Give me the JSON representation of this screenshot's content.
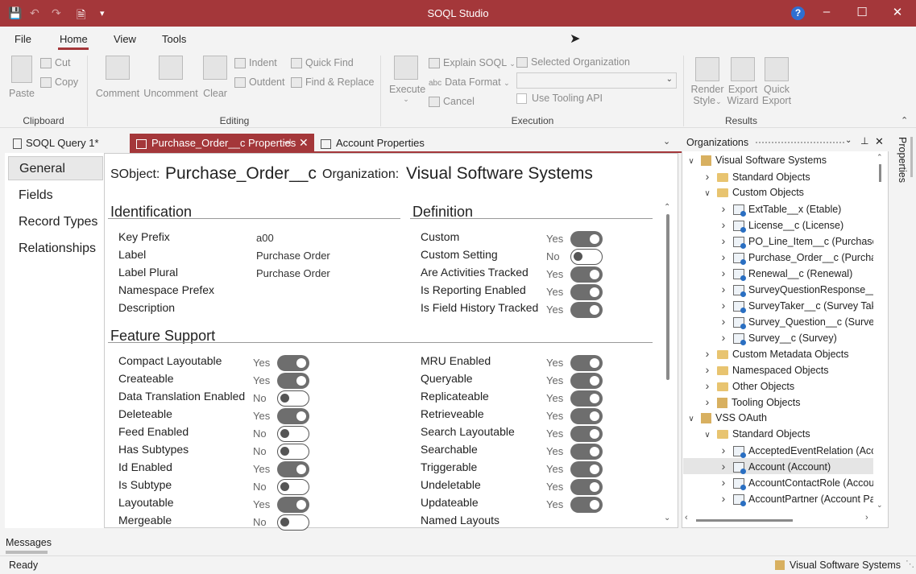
{
  "window": {
    "title": "SOQL Studio"
  },
  "menu": {
    "file": "File",
    "home": "Home",
    "view": "View",
    "tools": "Tools"
  },
  "ribbon": {
    "paste": "Paste",
    "cut": "Cut",
    "copy": "Copy",
    "clipboard_group": "Clipboard",
    "comment": "Comment",
    "uncomment": "Uncomment",
    "clear": "Clear",
    "indent": "Indent",
    "outdent": "Outdent",
    "quick_find": "Quick Find",
    "find_replace": "Find & Replace",
    "editing_group": "Editing",
    "execute": "Execute",
    "explain_soql": "Explain SOQL",
    "data_format": "Data Format",
    "cancel": "Cancel",
    "selected_org": "Selected Organization",
    "use_tooling_api": "Use Tooling API",
    "execution_group": "Execution",
    "render_style_1": "Render",
    "render_style_2": "Style",
    "export_wizard_1": "Export",
    "export_wizard_2": "Wizard",
    "quick_export_1": "Quick",
    "quick_export_2": "Export",
    "results_group": "Results"
  },
  "tabs": [
    {
      "label": "SOQL Query 1*"
    },
    {
      "label": "Purchase_Order__c Properties"
    },
    {
      "label": "Account Properties"
    }
  ],
  "nav": {
    "items": [
      "General",
      "Fields",
      "Record Types",
      "Relationships"
    ]
  },
  "header": {
    "sobject_label": "SObject:",
    "sobject_value": "Purchase_Order__c",
    "org_label": "Organization:",
    "org_value": "Visual Software Systems"
  },
  "identification": {
    "title": "Identification",
    "rows": [
      {
        "label": "Key Prefix",
        "value": "a00"
      },
      {
        "label": "Label",
        "value": "Purchase Order"
      },
      {
        "label": "Label Plural",
        "value": "Purchase Order"
      },
      {
        "label": "Namespace Prefex",
        "value": ""
      },
      {
        "label": "Description",
        "value": ""
      }
    ]
  },
  "definition": {
    "title": "Definition",
    "rows": [
      {
        "label": "Custom",
        "yn": "Yes",
        "on": true
      },
      {
        "label": "Custom Setting",
        "yn": "No",
        "on": false
      },
      {
        "label": "Are Activities Tracked",
        "yn": "Yes",
        "on": true
      },
      {
        "label": "Is Reporting Enabled",
        "yn": "Yes",
        "on": true
      },
      {
        "label": "Is Field History Tracked",
        "yn": "Yes",
        "on": true
      }
    ]
  },
  "feature_support": {
    "title": "Feature Support",
    "left": [
      {
        "label": "Compact Layoutable",
        "yn": "Yes",
        "on": true
      },
      {
        "label": "Createable",
        "yn": "Yes",
        "on": true
      },
      {
        "label": "Data Translation Enabled",
        "yn": "No",
        "on": false
      },
      {
        "label": "Deleteable",
        "yn": "Yes",
        "on": true
      },
      {
        "label": "Feed Enabled",
        "yn": "No",
        "on": false
      },
      {
        "label": "Has Subtypes",
        "yn": "No",
        "on": false
      },
      {
        "label": "Id Enabled",
        "yn": "Yes",
        "on": true
      },
      {
        "label": "Is Subtype",
        "yn": "No",
        "on": false
      },
      {
        "label": "Layoutable",
        "yn": "Yes",
        "on": true
      },
      {
        "label": "Mergeable",
        "yn": "No",
        "on": false
      }
    ],
    "right": [
      {
        "label": "MRU Enabled",
        "yn": "Yes",
        "on": true
      },
      {
        "label": "Queryable",
        "yn": "Yes",
        "on": true
      },
      {
        "label": "Replicateable",
        "yn": "Yes",
        "on": true
      },
      {
        "label": "Retrieveable",
        "yn": "Yes",
        "on": true
      },
      {
        "label": "Search Layoutable",
        "yn": "Yes",
        "on": true
      },
      {
        "label": "Searchable",
        "yn": "Yes",
        "on": true
      },
      {
        "label": "Triggerable",
        "yn": "Yes",
        "on": true
      },
      {
        "label": "Undeletable",
        "yn": "Yes",
        "on": true
      },
      {
        "label": "Updateable",
        "yn": "Yes",
        "on": true
      },
      {
        "label": "Named Layouts",
        "yn": "",
        "on": null
      }
    ]
  },
  "org_panel": {
    "title": "Organizations",
    "tree": [
      {
        "depth": 0,
        "exp": "open",
        "icon": "org",
        "label": "Visual Software Systems"
      },
      {
        "depth": 1,
        "exp": "closed",
        "icon": "folder",
        "label": "Standard Objects"
      },
      {
        "depth": 1,
        "exp": "open",
        "icon": "folder",
        "label": "Custom Objects"
      },
      {
        "depth": 2,
        "exp": "closed",
        "icon": "obj",
        "label": "ExtTable__x (Etable)"
      },
      {
        "depth": 2,
        "exp": "closed",
        "icon": "obj",
        "label": "License__c (License)"
      },
      {
        "depth": 2,
        "exp": "closed",
        "icon": "obj",
        "label": "PO_Line_Item__c (Purchase Or"
      },
      {
        "depth": 2,
        "exp": "closed",
        "icon": "obj",
        "label": "Purchase_Order__c (Purchase"
      },
      {
        "depth": 2,
        "exp": "closed",
        "icon": "obj",
        "label": "Renewal__c (Renewal)"
      },
      {
        "depth": 2,
        "exp": "closed",
        "icon": "obj",
        "label": "SurveyQuestionResponse__c ("
      },
      {
        "depth": 2,
        "exp": "closed",
        "icon": "obj",
        "label": "SurveyTaker__c (Survey Taken)"
      },
      {
        "depth": 2,
        "exp": "closed",
        "icon": "obj",
        "label": "Survey_Question__c (Survey C"
      },
      {
        "depth": 2,
        "exp": "closed",
        "icon": "obj",
        "label": "Survey__c (Survey)"
      },
      {
        "depth": 1,
        "exp": "closed",
        "icon": "folder",
        "label": "Custom Metadata Objects"
      },
      {
        "depth": 1,
        "exp": "closed",
        "icon": "folder",
        "label": "Namespaced Objects"
      },
      {
        "depth": 1,
        "exp": "closed",
        "icon": "folder",
        "label": "Other Objects"
      },
      {
        "depth": 1,
        "exp": "closed",
        "icon": "tool",
        "label": "Tooling Objects"
      },
      {
        "depth": 0,
        "exp": "open",
        "icon": "org",
        "label": "VSS OAuth"
      },
      {
        "depth": 1,
        "exp": "open",
        "icon": "folder",
        "label": "Standard Objects"
      },
      {
        "depth": 2,
        "exp": "closed",
        "icon": "obj",
        "label": "AcceptedEventRelation (Accep"
      },
      {
        "depth": 2,
        "exp": "closed",
        "icon": "obj",
        "label": "Account (Account)",
        "selected": true
      },
      {
        "depth": 2,
        "exp": "closed",
        "icon": "obj",
        "label": "AccountContactRole (Account"
      },
      {
        "depth": 2,
        "exp": "closed",
        "icon": "obj",
        "label": "AccountPartner (Account Part"
      }
    ]
  },
  "side": {
    "properties": "Properties"
  },
  "messages": {
    "label": "Messages"
  },
  "status": {
    "ready": "Ready",
    "org": "Visual Software Systems"
  }
}
